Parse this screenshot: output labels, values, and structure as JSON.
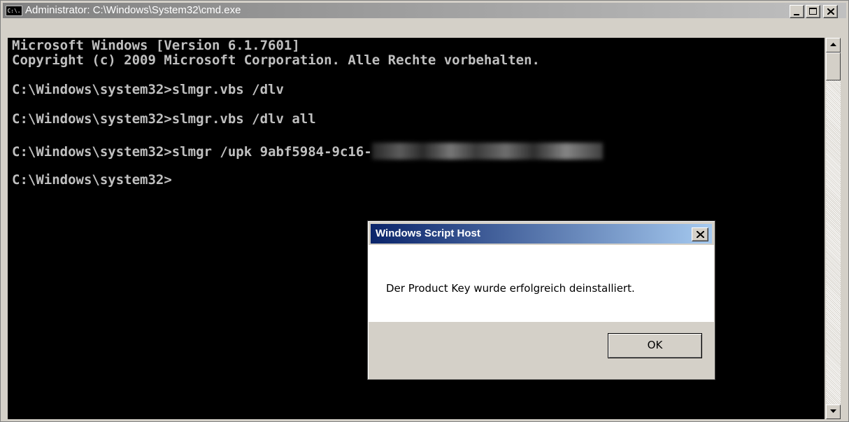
{
  "window": {
    "title": "Administrator: C:\\Windows\\System32\\cmd.exe",
    "icon": "cmd-icon",
    "icon_text": "C:\\."
  },
  "console": {
    "lines": [
      "Microsoft Windows [Version 6.1.7601]",
      "Copyright (c) 2009 Microsoft Corporation. Alle Rechte vorbehalten.",
      "C:\\Windows\\system32>slmgr.vbs /dlv",
      "C:\\Windows\\system32>slmgr.vbs /dlv all",
      "C:\\Windows\\system32>slmgr /upk 9abf5984-9c16-",
      "C:\\Windows\\system32>"
    ]
  },
  "dialog": {
    "title": "Windows Script Host",
    "message": "Der Product Key wurde erfolgreich deinstalliert.",
    "ok_label": "OK"
  },
  "colors": {
    "console_bg": "#000000",
    "console_text": "#c0c0c0",
    "dialog_title_bg": "#0a246a",
    "face": "#d4d0c8"
  }
}
